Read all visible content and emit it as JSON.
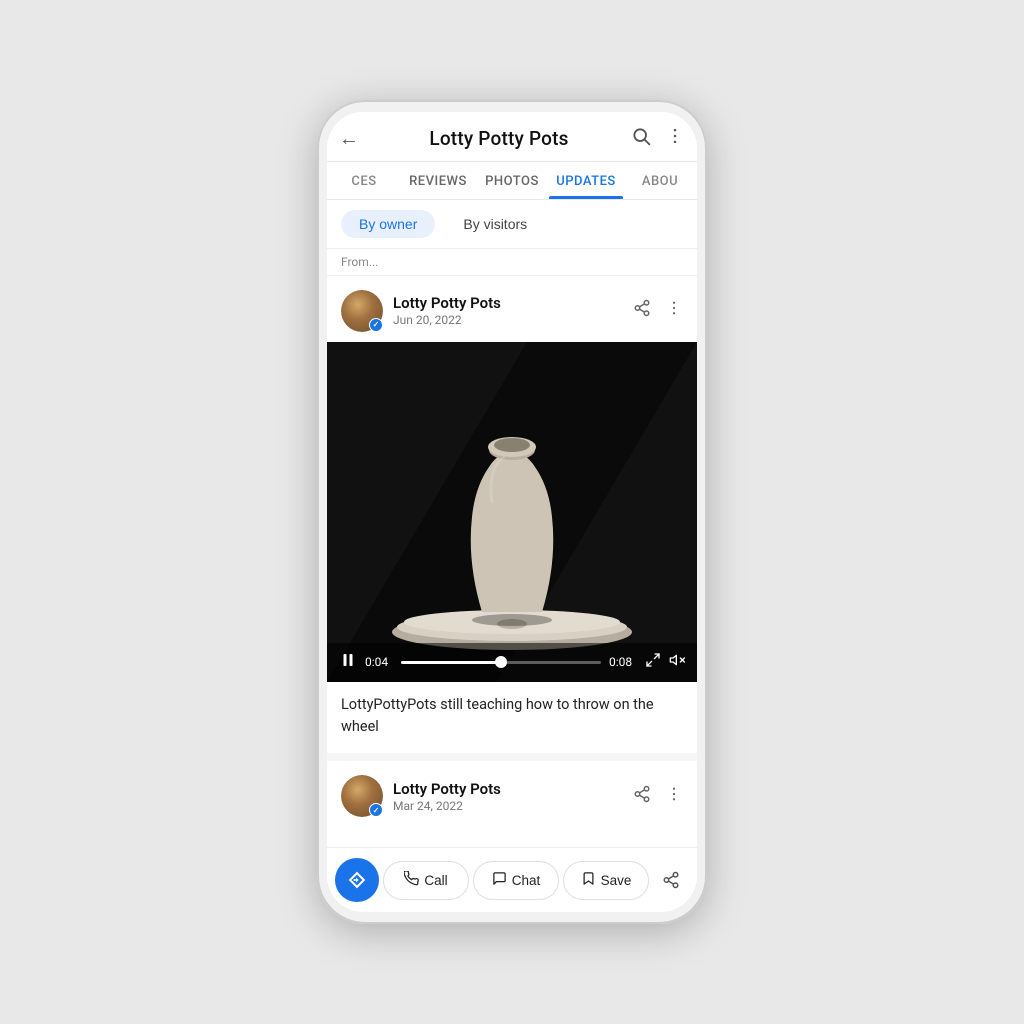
{
  "header": {
    "back_label": "←",
    "title": "Lotty Potty Pots",
    "search_icon": "search-icon",
    "more_icon": "more-icon"
  },
  "tabs": [
    {
      "id": "ces",
      "label": "CES",
      "active": false,
      "partial": true
    },
    {
      "id": "reviews",
      "label": "REVIEWS",
      "active": false
    },
    {
      "id": "photos",
      "label": "PHOTOS",
      "active": false
    },
    {
      "id": "updates",
      "label": "UPDATES",
      "active": true
    },
    {
      "id": "about",
      "label": "ABOU",
      "active": false,
      "partial": true
    }
  ],
  "filters": {
    "by_owner": "By owner",
    "by_visitors": "By visitors"
  },
  "hint_text": "From...",
  "posts": [
    {
      "id": "post1",
      "author": "Lotty Potty Pots",
      "date": "Jun 20, 2022",
      "verified": true,
      "caption": "LottyPottyPots still teaching how to throw on the wheel",
      "video": {
        "current_time": "0:04",
        "total_time": "0:08",
        "progress_pct": 50
      }
    },
    {
      "id": "post2",
      "author": "Lotty Potty Pots",
      "date": "Mar 24, 2022",
      "verified": true
    }
  ],
  "bottom_bar": {
    "fab_icon": "directions-icon",
    "call_label": "Call",
    "chat_label": "Chat",
    "save_label": "Save",
    "share_icon": "share-icon"
  }
}
